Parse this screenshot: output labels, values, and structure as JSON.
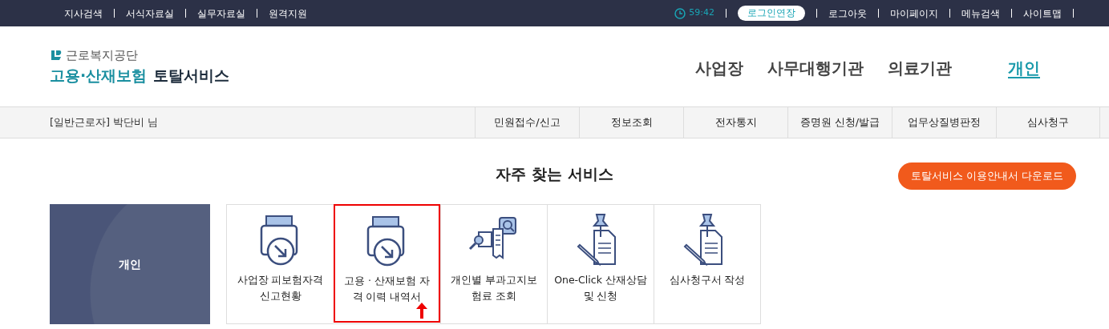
{
  "top_bar": {
    "left_links": [
      "지사검색",
      "서식자료실",
      "실무자료실",
      "원격지원"
    ],
    "timer": "59:42",
    "extend_button": "로그인연장",
    "right_links": [
      "로그아웃",
      "마이페이지",
      "메뉴검색",
      "사이트맵"
    ]
  },
  "header": {
    "org": "근로복지공단",
    "service_title_accent": "고용·산재보험",
    "service_title": "토탈서비스",
    "nav": [
      {
        "label": "사업장",
        "selected": false
      },
      {
        "label": "사무대행기관",
        "selected": false
      },
      {
        "label": "의료기관",
        "selected": false
      },
      {
        "label": "개인",
        "selected": true
      }
    ]
  },
  "user_bar": {
    "user": "[일반근로자] 박단비 님",
    "menu": [
      "민원접수/신고",
      "정보조회",
      "전자통지",
      "증명원 신청/발급",
      "업무상질병판정",
      "심사청구"
    ]
  },
  "section": {
    "title": "자주 찾는 서비스",
    "download_button": "토탈서비스 이용안내서 다운로드",
    "category": "개인",
    "services": [
      {
        "label": "사업장 피보험자격 신고현황",
        "kind": "scanner",
        "highlighted": false
      },
      {
        "label": "고용 · 산재보험 자격 이력 내역서",
        "kind": "scanner",
        "highlighted": true
      },
      {
        "label": "개인별 부과고지보험료 조회",
        "kind": "search-docs",
        "highlighted": false
      },
      {
        "label": "One-Click 산재상담 및 신청",
        "kind": "pin-doc",
        "highlighted": false
      },
      {
        "label": "심사청구서 작성",
        "kind": "pin-doc",
        "highlighted": false
      }
    ]
  }
}
